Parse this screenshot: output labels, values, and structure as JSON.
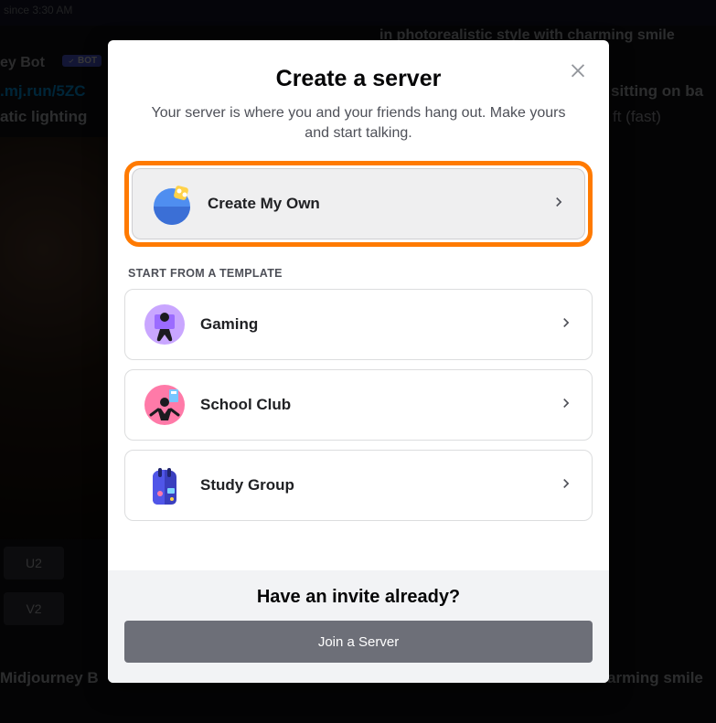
{
  "background": {
    "status_text": "since 3:30 AM",
    "bot_name": "ey Bot",
    "bot_badge_label": "BOT",
    "link_text": ".mj.run/5ZC",
    "line2_text": "atic lighting",
    "rt_text1": "in photorealistic style with charming smile",
    "rt_text2": "sitting on ba",
    "rt_text3": "ft (fast)",
    "bottom_text": "Midjourney B",
    "bottom_text_r": "arming smile",
    "buttons_row1": [
      "U2"
    ],
    "buttons_row2": [
      "V2"
    ]
  },
  "modal": {
    "title": "Create a server",
    "subtitle": "Your server is where you and your friends hang out. Make yours and start talking.",
    "primary_option": {
      "label": "Create My Own"
    },
    "template_section_label": "START FROM A TEMPLATE",
    "templates": [
      {
        "label": "Gaming"
      },
      {
        "label": "School Club"
      },
      {
        "label": "Study Group"
      }
    ],
    "footer": {
      "title": "Have an invite already?",
      "button": "Join a Server"
    }
  }
}
